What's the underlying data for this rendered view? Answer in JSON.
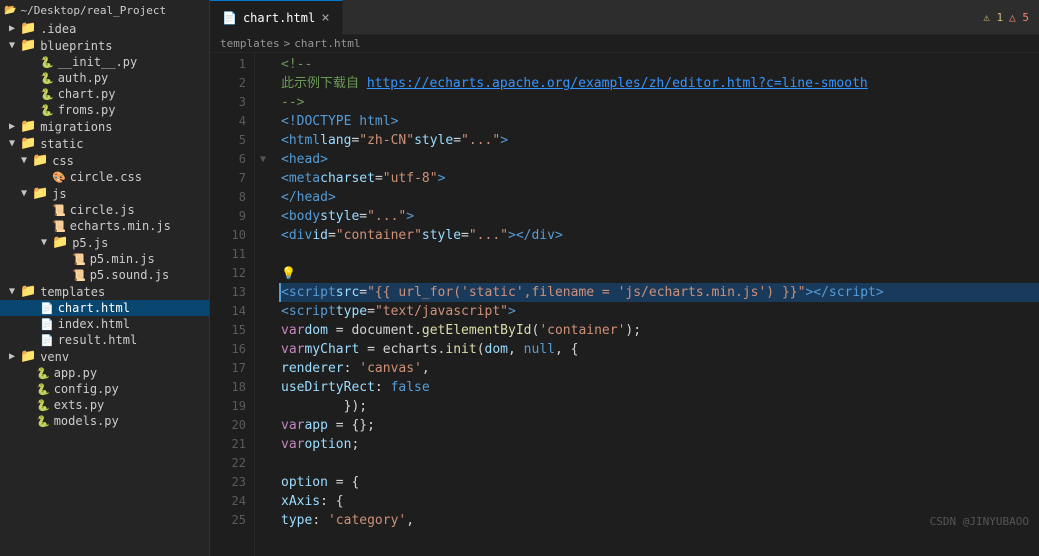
{
  "sidebar": {
    "root": "~/Desktop/real_Project",
    "items": [
      {
        "id": "idea",
        "label": ".idea",
        "type": "folder",
        "level": 1,
        "expanded": false,
        "arrow": "▶"
      },
      {
        "id": "blueprints",
        "label": "blueprints",
        "type": "folder",
        "level": 1,
        "expanded": true,
        "arrow": "▼"
      },
      {
        "id": "init_py",
        "label": "__init__.py",
        "type": "py",
        "level": 2
      },
      {
        "id": "auth_py",
        "label": "auth.py",
        "type": "py",
        "level": 2
      },
      {
        "id": "chart_py",
        "label": "chart.py",
        "type": "py",
        "level": 2
      },
      {
        "id": "froms_py",
        "label": "froms.py",
        "type": "py",
        "level": 2
      },
      {
        "id": "migrations",
        "label": "migrations",
        "type": "folder",
        "level": 1,
        "expanded": false,
        "arrow": "▶"
      },
      {
        "id": "static",
        "label": "static",
        "type": "folder",
        "level": 1,
        "expanded": true,
        "arrow": "▼"
      },
      {
        "id": "css",
        "label": "css",
        "type": "folder",
        "level": 2,
        "expanded": true,
        "arrow": "▼"
      },
      {
        "id": "circle_css",
        "label": "circle.css",
        "type": "css",
        "level": 3
      },
      {
        "id": "js",
        "label": "js",
        "type": "folder",
        "level": 2,
        "expanded": true,
        "arrow": "▼"
      },
      {
        "id": "circle_js",
        "label": "circle.js",
        "type": "js",
        "level": 3
      },
      {
        "id": "echarts_min_js",
        "label": "echarts.min.js",
        "type": "js",
        "level": 3
      },
      {
        "id": "p5_js",
        "label": "p5.js",
        "type": "folder",
        "level": 3,
        "expanded": true,
        "arrow": "▼"
      },
      {
        "id": "p5_min_js",
        "label": "p5.min.js",
        "type": "js",
        "level": 4
      },
      {
        "id": "p5_sound_js",
        "label": "p5.sound.js",
        "type": "js",
        "level": 4
      },
      {
        "id": "templates",
        "label": "templates",
        "type": "folder",
        "level": 1,
        "expanded": true,
        "arrow": "▼"
      },
      {
        "id": "chart_html",
        "label": "chart.html",
        "type": "html",
        "level": 2,
        "selected": true
      },
      {
        "id": "index_html",
        "label": "index.html",
        "type": "html",
        "level": 2
      },
      {
        "id": "result_html",
        "label": "result.html",
        "type": "html",
        "level": 2
      },
      {
        "id": "venv",
        "label": "venv",
        "type": "folder",
        "level": 1,
        "expanded": false,
        "arrow": "▶"
      },
      {
        "id": "app_py",
        "label": "app.py",
        "type": "py",
        "level": 1
      },
      {
        "id": "config_py",
        "label": "config.py",
        "type": "py",
        "level": 1
      },
      {
        "id": "exts_py",
        "label": "exts.py",
        "type": "py",
        "level": 1
      },
      {
        "id": "models_py",
        "label": "models.py",
        "type": "py",
        "level": 1
      }
    ]
  },
  "editor": {
    "active_tab": "chart.html",
    "tabs": [
      {
        "id": "tab1",
        "label": "chart.html",
        "active": true
      }
    ],
    "breadcrumb": "templates > chart.html",
    "warnings": 1,
    "errors": 5
  },
  "code_lines": [
    {
      "num": 1,
      "fold": "",
      "content_html": "<span class='c-comment'>&lt;!--</span>"
    },
    {
      "num": 2,
      "fold": "",
      "content_html": "    <span class='c-comment'>此示例下载自 <a class='c-link' href='#'>https://echarts.apache.org/examples/zh/editor.html?c=line-smooth</a></span>"
    },
    {
      "num": 3,
      "fold": "",
      "content_html": "<span class='c-comment'>--&gt;</span>"
    },
    {
      "num": 4,
      "fold": "",
      "content_html": "    <span class='c-tag'>&lt;!DOCTYPE html&gt;</span>"
    },
    {
      "num": 5,
      "fold": "",
      "content_html": "    <span class='c-tag'>&lt;html</span> <span class='c-attr'>lang</span>=<span class='c-string'>\"zh-CN\"</span> <span class='c-attr'>style</span>=<span class='c-string'>\"...\"</span><span class='c-tag'>&gt;</span>"
    },
    {
      "num": 6,
      "fold": "▼",
      "content_html": "    <span class='c-tag'>&lt;head&gt;</span>"
    },
    {
      "num": 7,
      "fold": "",
      "content_html": "        <span class='c-tag'>&lt;meta</span> <span class='c-attr'>charset</span>=<span class='c-string'>\"utf-8\"</span><span class='c-tag'>&gt;</span>"
    },
    {
      "num": 8,
      "fold": "",
      "content_html": "    <span class='c-tag'>&lt;/head&gt;</span>"
    },
    {
      "num": 9,
      "fold": "",
      "content_html": "    <span class='c-tag'>&lt;body</span> <span class='c-attr'>style</span>=<span class='c-string'>\"...\"</span><span class='c-tag'>&gt;</span>"
    },
    {
      "num": 10,
      "fold": "",
      "content_html": "        <span class='c-tag'>&lt;div</span> <span class='c-attr'>id</span>=<span class='c-string'>\"container\"</span> <span class='c-attr'>style</span>=<span class='c-string'>\"...\"</span><span class='c-tag'>&gt;&lt;/div&gt;</span>"
    },
    {
      "num": 11,
      "fold": "",
      "content_html": ""
    },
    {
      "num": 12,
      "fold": "",
      "content_html": "    <span class='lightbulb'>💡</span>"
    },
    {
      "num": 13,
      "fold": "",
      "content_html": "    <span class='c-tag'>&lt;script</span>  <span class='c-attr'>src</span>=<span class='c-string'>\"{{ url_for(<span class='c-string'>'static'</span>,filename = <span class='c-string'>'js/echarts.min.js'</span>) }}\"</span><span class='c-tag'>&gt;&lt;/script&gt;</span>",
      "highlighted": true
    },
    {
      "num": 14,
      "fold": "",
      "content_html": "    <span class='c-tag'>&lt;script</span> <span class='c-attr'>type</span>=<span class='c-string'>\"text/javascript\"</span><span class='c-tag'>&gt;</span>"
    },
    {
      "num": 15,
      "fold": "",
      "content_html": "        <span class='c-keyword'>var</span> <span class='c-lightblue'>dom</span> = <span class='c-white'>document.</span><span class='c-func'>getElementById</span>(<span class='c-string'>'container'</span>);"
    },
    {
      "num": 16,
      "fold": "",
      "content_html": "        <span class='c-keyword'>var</span> <span class='c-lightblue'>myChart</span> = <span class='c-white'>echarts.</span><span class='c-func'>init</span>(<span class='c-lightblue'>dom</span>, <span class='c-blue'>null</span>, {"
    },
    {
      "num": 17,
      "fold": "",
      "content_html": "            <span class='c-lightblue'>renderer</span>: <span class='c-string'>'canvas'</span>,"
    },
    {
      "num": 18,
      "fold": "",
      "content_html": "            <span class='c-lightblue'>useDirtyRect</span>: <span class='c-blue'>false</span>"
    },
    {
      "num": 19,
      "fold": "",
      "content_html": "        });"
    },
    {
      "num": 20,
      "fold": "",
      "content_html": "        <span class='c-keyword'>var</span> <span class='c-lightblue'>app</span> = {};"
    },
    {
      "num": 21,
      "fold": "",
      "content_html": "        <span class='c-keyword'>var</span> <span class='c-lightblue'>option</span>;"
    },
    {
      "num": 22,
      "fold": "",
      "content_html": ""
    },
    {
      "num": 23,
      "fold": "",
      "content_html": "        <span class='c-lightblue'>option</span> = {"
    },
    {
      "num": 24,
      "fold": "",
      "content_html": "            <span class='c-lightblue'>xAxis</span>: {"
    },
    {
      "num": 25,
      "fold": "",
      "content_html": "                <span class='c-lightblue'>type</span>: <span class='c-string'>'category'</span>,"
    }
  ],
  "watermark": "CSDN @JINYUBAOO",
  "bottom_bar": {
    "label": ""
  },
  "icons": {
    "folder": "📁",
    "py": "🐍",
    "html": "📄",
    "css": "🎨",
    "js": "📜",
    "arrow_right": "▶",
    "arrow_down": "▼"
  }
}
